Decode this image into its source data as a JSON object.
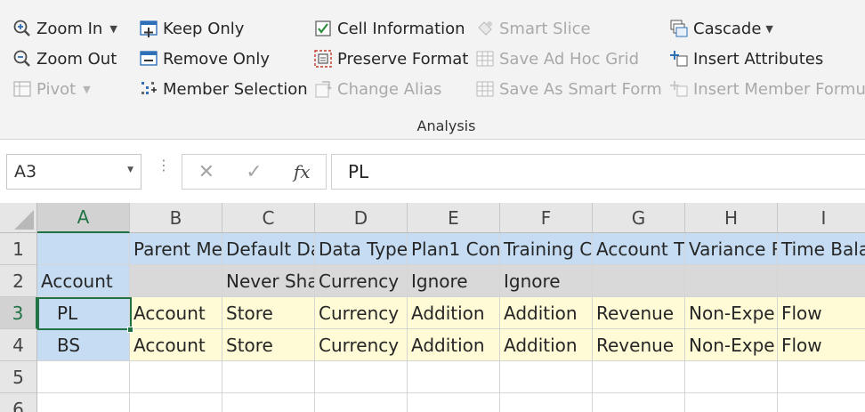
{
  "ribbon": {
    "group_label": "Analysis",
    "col1": {
      "zoom_in": "Zoom In",
      "zoom_out": "Zoom Out",
      "pivot": "Pivot"
    },
    "col2": {
      "keep_only": "Keep Only",
      "remove_only": "Remove Only",
      "member_selection": "Member Selection"
    },
    "col3": {
      "cell_information": "Cell Information",
      "preserve_format": "Preserve Format",
      "change_alias": "Change Alias"
    },
    "col4": {
      "smart_slice": "Smart Slice",
      "save_ad_hoc_grid": "Save Ad Hoc Grid",
      "save_as_smart_form": "Save As Smart Form"
    },
    "col5": {
      "cascade": "Cascade",
      "insert_attributes": "Insert Attributes",
      "insert_member_formula": "Insert Member Formul"
    }
  },
  "formula_bar": {
    "name_box": "A3",
    "cancel_glyph": "✕",
    "enter_glyph": "✓",
    "fx_label": "fx",
    "content": "PL"
  },
  "sheet": {
    "columns": [
      "A",
      "B",
      "C",
      "D",
      "E",
      "F",
      "G",
      "H",
      "I"
    ],
    "rows": [
      "1",
      "2",
      "3",
      "4",
      "5",
      "6"
    ],
    "cells": {
      "r1": [
        "",
        "Parent Me",
        "Default Da",
        "Data Type",
        "Plan1 Con",
        "Training C",
        "Account T",
        "Variance R",
        "Time Bala"
      ],
      "r2": [
        "Account",
        "",
        "Never Sha",
        "Currency",
        "Ignore",
        "Ignore",
        "",
        "",
        ""
      ],
      "r3": [
        "PL",
        "Account",
        "Store",
        "Currency",
        "Addition",
        "Addition",
        "Revenue",
        "Non-Expe",
        "Flow"
      ],
      "r4": [
        "BS",
        "Account",
        "Store",
        "Currency",
        "Addition",
        "Addition",
        "Revenue",
        "Non-Expe",
        "Flow"
      ],
      "r5": [
        "",
        "",
        "",
        "",
        "",
        "",
        "",
        "",
        ""
      ],
      "r6": [
        "",
        "",
        "",
        "",
        "",
        "",
        "",
        "",
        ""
      ]
    }
  },
  "colors": {
    "header_blue": "#c6dcf2",
    "member_gray": "#d9d9d9",
    "data_yellow": "#fffbd6",
    "selection_green": "#217346"
  }
}
